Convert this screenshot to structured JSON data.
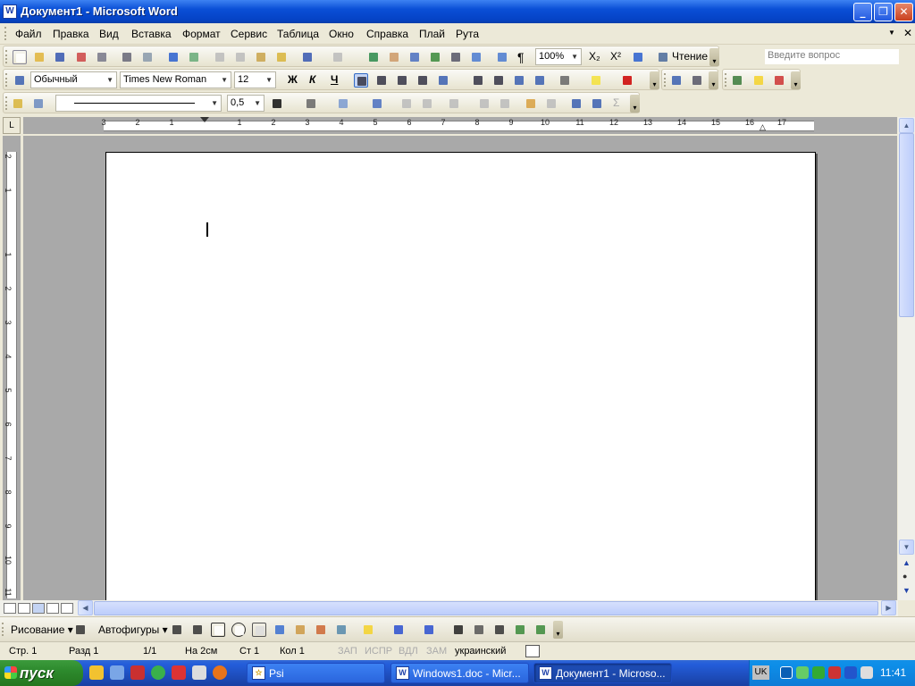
{
  "window": {
    "title": "Документ1 - Microsoft Word",
    "icon": "word-doc-icon"
  },
  "menu": {
    "items": [
      "Файл",
      "Правка",
      "Вид",
      "Вставка",
      "Формат",
      "Сервис",
      "Таблица",
      "Окно",
      "Справка",
      "Плай",
      "Рута"
    ],
    "ask_placeholder": "Введите вопрос"
  },
  "toolbar_standard": {
    "zoom": "100%",
    "reading_label": "Чтение"
  },
  "toolbar_format": {
    "style": "Обычный",
    "font": "Times New Roman",
    "size": "12",
    "bold": "Ж",
    "italic": "К",
    "underline": "Ч"
  },
  "toolbar_draw": {
    "line_weight": "0,5"
  },
  "ruler": {
    "h_labels": [
      "3",
      "2",
      "1",
      "1",
      "2",
      "3",
      "4",
      "5",
      "6",
      "7",
      "8",
      "9",
      "10",
      "11",
      "12",
      "13",
      "14",
      "15",
      "16",
      "17"
    ],
    "v_labels": [
      "2",
      "1",
      "1",
      "2",
      "3",
      "4",
      "5",
      "6",
      "7",
      "8",
      "9",
      "10",
      "11"
    ]
  },
  "drawing": {
    "draw_label": "Рисование",
    "autoshapes_label": "Автофигуры"
  },
  "status": {
    "page": "Стр. 1",
    "section": "Разд 1",
    "pages": "1/1",
    "at": "На 2см",
    "line": "Ст 1",
    "col": "Кол 1",
    "rec": "ЗАП",
    "trk": "ИСПР",
    "ext": "ВДЛ",
    "ovr": "ЗАМ",
    "lang": "украинский"
  },
  "taskbar": {
    "start": "пуск",
    "tasks": [
      {
        "label": "Psi"
      },
      {
        "label": "Windows1.doc - Micr..."
      },
      {
        "label": "Документ1 - Microso..."
      }
    ],
    "lang": "UK",
    "clock": "11:41"
  }
}
